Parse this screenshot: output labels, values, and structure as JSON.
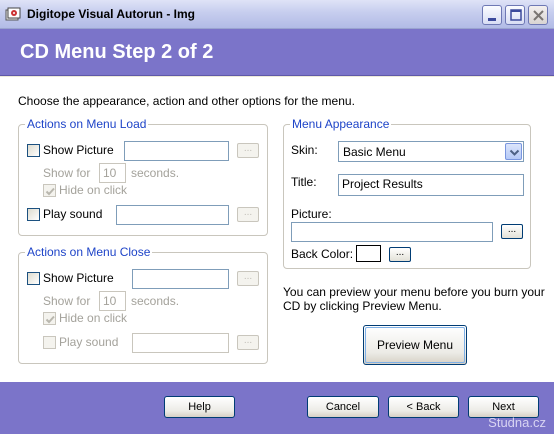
{
  "window": {
    "title": "Digitope Visual Autorun - Img"
  },
  "header": {
    "title": "CD Menu Step 2 of 2"
  },
  "intro": "Choose the appearance, action and other options for the menu.",
  "load_group": {
    "legend": "Actions on Menu Load",
    "show_picture": {
      "label": "Show Picture",
      "checked": false,
      "value": ""
    },
    "show_for": {
      "prefix": "Show for",
      "value": "10",
      "suffix": "seconds."
    },
    "hide_on_click": {
      "label": "Hide on click",
      "checked": true
    },
    "play_sound": {
      "label": "Play sound",
      "checked": false,
      "value": ""
    },
    "browse_label": "..."
  },
  "close_group": {
    "legend": "Actions on Menu Close",
    "show_picture": {
      "label": "Show Picture",
      "checked": false,
      "value": ""
    },
    "show_for": {
      "prefix": "Show for",
      "value": "10",
      "suffix": "seconds."
    },
    "hide_on_click": {
      "label": "Hide on click",
      "checked": true
    },
    "play_sound": {
      "label": "Play sound",
      "checked": false,
      "value": ""
    },
    "browse_label": "..."
  },
  "appearance_group": {
    "legend": "Menu Appearance",
    "skin_label": "Skin:",
    "skin_value": "Basic Menu",
    "title_label": "Title:",
    "title_value": "Project Results",
    "picture_label": "Picture:",
    "picture_value": "",
    "back_color_label": "Back Color:",
    "back_color_value": "#ffffff",
    "browse_label": "..."
  },
  "preview": {
    "help_text": "You can preview your menu before you burn your CD by clicking Preview Menu.",
    "button_label": "Preview Menu"
  },
  "footer": {
    "help_label": "Help",
    "cancel_label": "Cancel",
    "back_label": "< Back",
    "next_label": "Next",
    "watermark": "Studna.cz"
  },
  "colors": {
    "banner": "#7b74c9",
    "group_legend": "#1e44c8",
    "disabled_text": "#a4a29b"
  }
}
